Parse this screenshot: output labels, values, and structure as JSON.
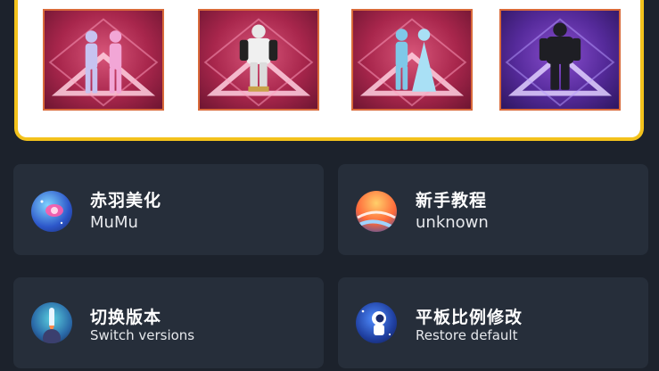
{
  "banner": {
    "skins": [
      {
        "icon": "duo-suits-skin-icon",
        "theme": "red"
      },
      {
        "icon": "armored-suit-skin-icon",
        "theme": "red"
      },
      {
        "icon": "princess-duo-skin-icon",
        "theme": "red"
      },
      {
        "icon": "dark-armor-skin-icon",
        "theme": "purple"
      }
    ]
  },
  "cards": [
    {
      "title": "赤羽美化",
      "subtitle": "MuMu",
      "icon": "planet-swirl-icon"
    },
    {
      "title": "新手教程",
      "subtitle": "unknown",
      "icon": "planet-ringed-icon"
    },
    {
      "title": "切换版本",
      "subtitle": "Switch versions",
      "icon": "rocket-planet-icon"
    },
    {
      "title": "平板比例修改",
      "subtitle": "Restore default",
      "icon": "astronaut-icon"
    }
  ],
  "colors": {
    "background": "#1c222c",
    "card": "#262e3a",
    "banner_border": "#f3c21c",
    "skin_frame": "#d96a3a"
  }
}
